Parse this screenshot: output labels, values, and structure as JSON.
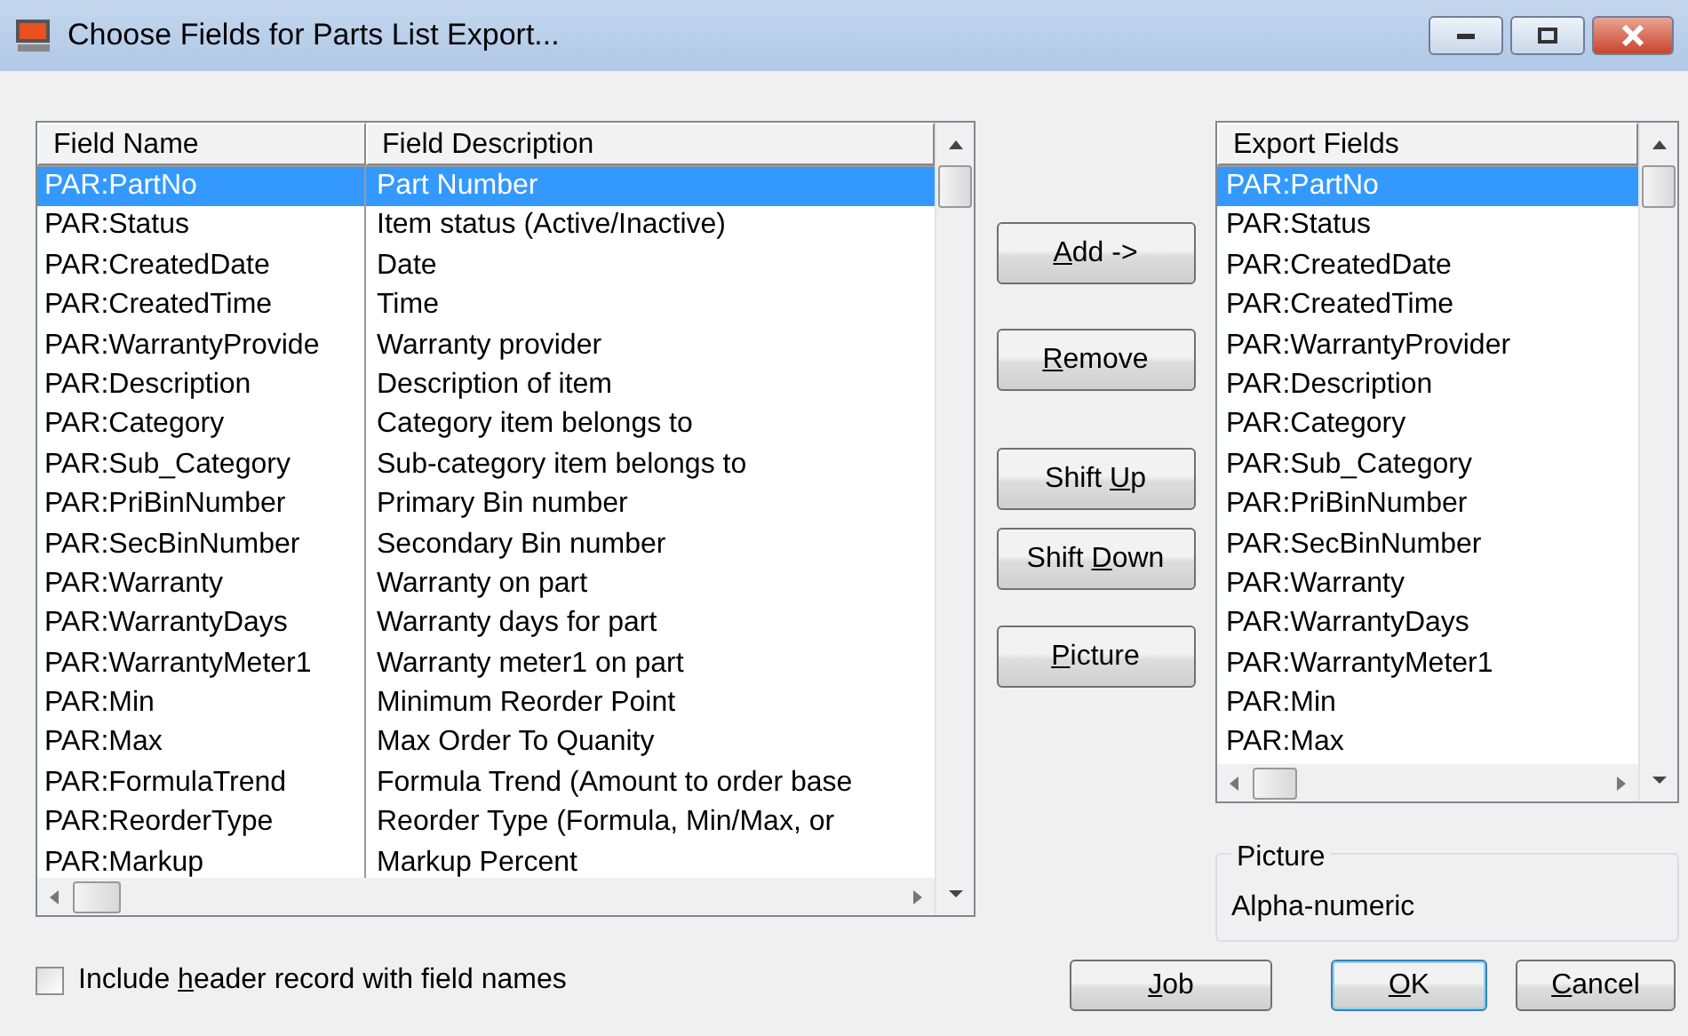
{
  "window": {
    "title": "Choose Fields for Parts List Export..."
  },
  "fields_table": {
    "columns": [
      "Field Name",
      "Field Description"
    ],
    "rows": [
      {
        "name": "PAR:PartNo",
        "description": "Part Number",
        "selected": true
      },
      {
        "name": "PAR:Status",
        "description": "Item status (Active/Inactive)",
        "selected": false
      },
      {
        "name": "PAR:CreatedDate",
        "description": "Date",
        "selected": false
      },
      {
        "name": "PAR:CreatedTime",
        "description": "Time",
        "selected": false
      },
      {
        "name": "PAR:WarrantyProvide",
        "description": "Warranty provider",
        "selected": false
      },
      {
        "name": "PAR:Description",
        "description": "Description of item",
        "selected": false
      },
      {
        "name": "PAR:Category",
        "description": "Category item belongs to",
        "selected": false
      },
      {
        "name": "PAR:Sub_Category",
        "description": "Sub-category item belongs to",
        "selected": false
      },
      {
        "name": "PAR:PriBinNumber",
        "description": "Primary Bin number",
        "selected": false
      },
      {
        "name": "PAR:SecBinNumber",
        "description": "Secondary Bin number",
        "selected": false
      },
      {
        "name": "PAR:Warranty",
        "description": "Warranty on part",
        "selected": false
      },
      {
        "name": "PAR:WarrantyDays",
        "description": "Warranty days for part",
        "selected": false
      },
      {
        "name": "PAR:WarrantyMeter1",
        "description": "Warranty meter1 on part",
        "selected": false
      },
      {
        "name": "PAR:Min",
        "description": "Minimum Reorder Point",
        "selected": false
      },
      {
        "name": "PAR:Max",
        "description": "Max Order To Quanity",
        "selected": false
      },
      {
        "name": "PAR:FormulaTrend",
        "description": "Formula Trend (Amount to order base",
        "selected": false
      },
      {
        "name": "PAR:ReorderType",
        "description": "Reorder Type (Formula, Min/Max, or",
        "selected": false
      },
      {
        "name": "PAR:Markup",
        "description": "Markup Percent",
        "selected": false
      }
    ]
  },
  "action_buttons": [
    {
      "label": {
        "key": "A",
        "after": "dd ->"
      }
    },
    {
      "label": {
        "key": "R",
        "after": "emove"
      }
    },
    {
      "label": {
        "before": "Shift ",
        "key": "U",
        "after": "p"
      }
    },
    {
      "label": {
        "before": "Shift ",
        "key": "D",
        "after": "own"
      }
    },
    {
      "label": {
        "key": "P",
        "after": "icture"
      }
    }
  ],
  "export_list": {
    "header": "Export Fields",
    "items": [
      {
        "label": "PAR:PartNo",
        "selected": true
      },
      {
        "label": "PAR:Status",
        "selected": false
      },
      {
        "label": "PAR:CreatedDate",
        "selected": false
      },
      {
        "label": "PAR:CreatedTime",
        "selected": false
      },
      {
        "label": "PAR:WarrantyProvider",
        "selected": false
      },
      {
        "label": "PAR:Description",
        "selected": false
      },
      {
        "label": "PAR:Category",
        "selected": false
      },
      {
        "label": "PAR:Sub_Category",
        "selected": false
      },
      {
        "label": "PAR:PriBinNumber",
        "selected": false
      },
      {
        "label": "PAR:SecBinNumber",
        "selected": false
      },
      {
        "label": "PAR:Warranty",
        "selected": false
      },
      {
        "label": "PAR:WarrantyDays",
        "selected": false
      },
      {
        "label": "PAR:WarrantyMeter1",
        "selected": false
      },
      {
        "label": "PAR:Min",
        "selected": false
      },
      {
        "label": "PAR:Max",
        "selected": false
      }
    ]
  },
  "picture_group": {
    "title": "Picture",
    "value": "Alpha-numeric"
  },
  "header_checkbox": {
    "label": {
      "before": "Include ",
      "key": "h",
      "after": "eader record with field names"
    },
    "checked": false
  },
  "dialog_buttons": [
    {
      "label": {
        "key": "J",
        "after": "ob"
      },
      "default": false
    },
    {
      "label": {
        "key": "O",
        "after": "K"
      },
      "default": true
    },
    {
      "label": {
        "key": "C",
        "after": "ancel"
      },
      "default": false
    }
  ]
}
